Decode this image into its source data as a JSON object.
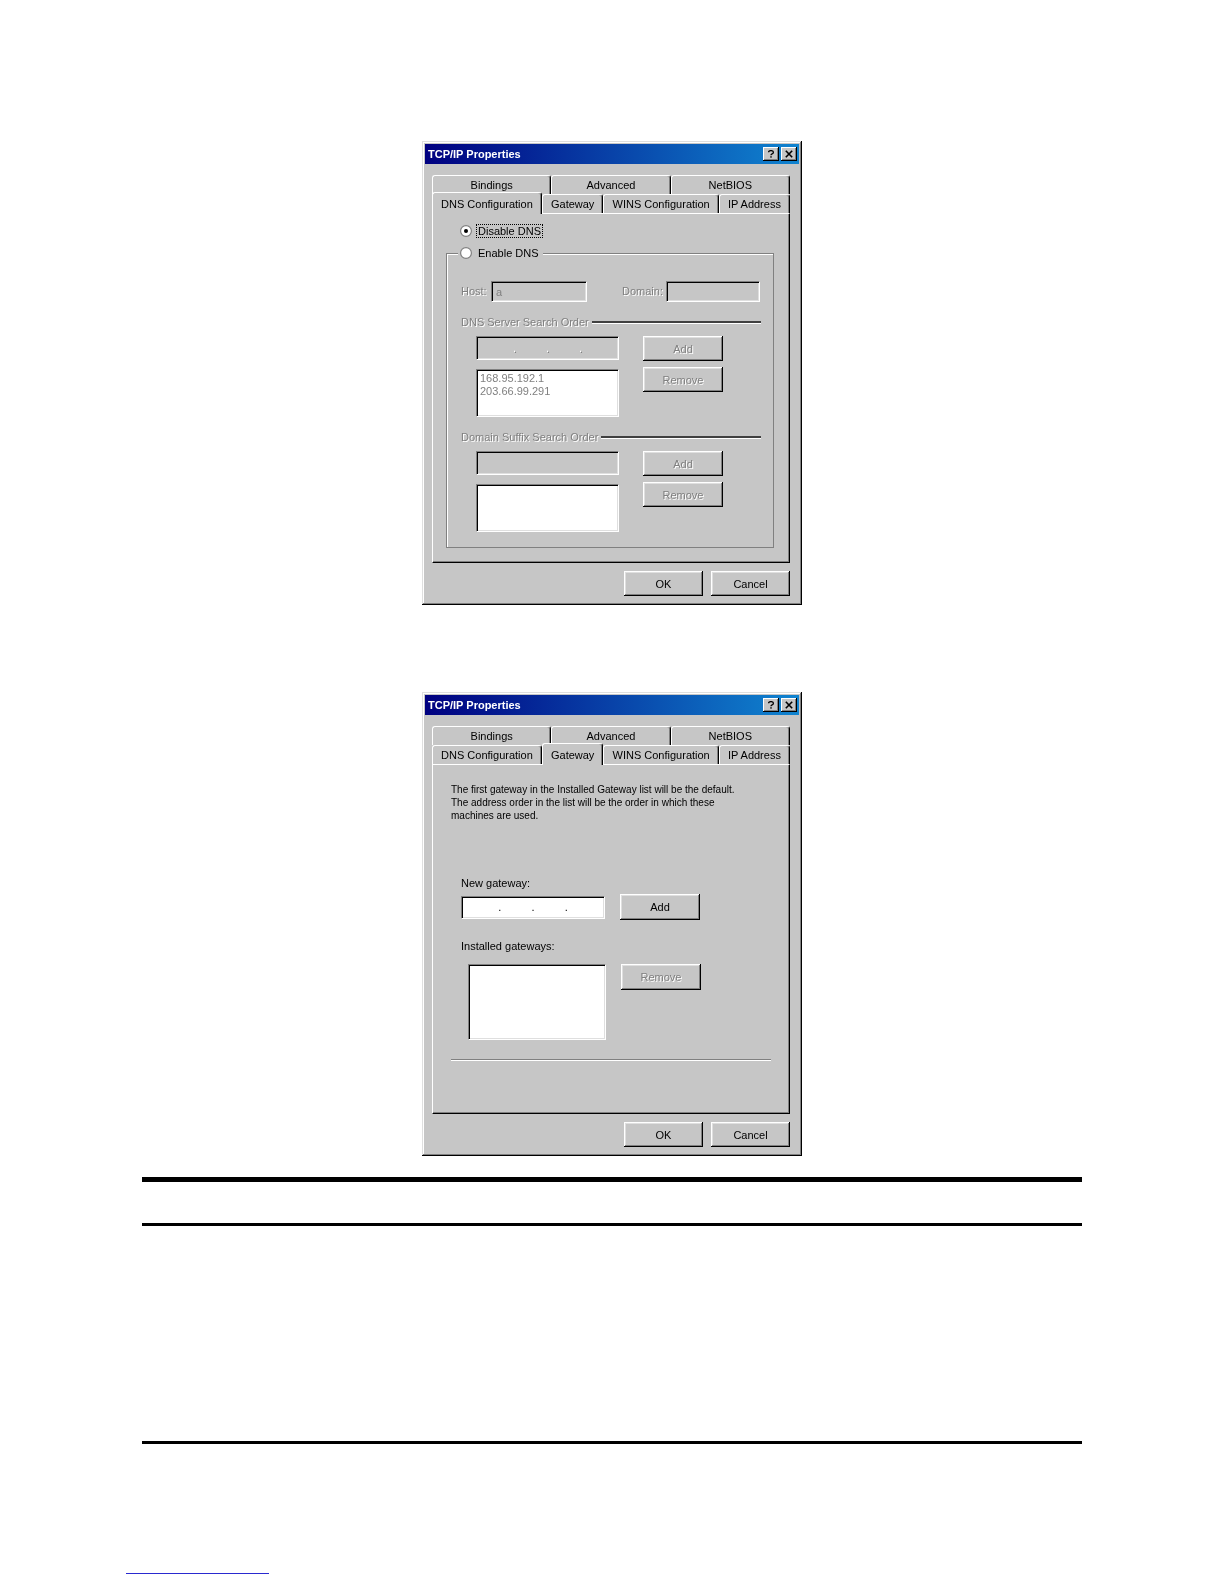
{
  "dialogs": [
    {
      "title": "TCP/IP Properties",
      "tab_rows": [
        [
          {
            "label": "Bindings",
            "selected": false
          },
          {
            "label": "Advanced",
            "selected": false
          },
          {
            "label": "NetBIOS",
            "selected": false
          }
        ],
        [
          {
            "label": "DNS Configuration",
            "selected": true
          },
          {
            "label": "Gateway",
            "selected": false
          },
          {
            "label": "WINS Configuration",
            "selected": false
          },
          {
            "label": "IP Address",
            "selected": false
          }
        ]
      ],
      "page": {
        "kind": "dns",
        "options": [
          {
            "label": "Disable DNS",
            "selected": true,
            "focused": true
          },
          {
            "label": "Enable DNS",
            "selected": false,
            "focused": false
          }
        ],
        "settings": {
          "disabled": true,
          "host": {
            "label": "Host:",
            "value": "a"
          },
          "domain": {
            "label": "Domain:"
          },
          "sections": [
            {
              "heading": "DNS Server Search Order",
              "entry": {
                "kind": "ip",
                "separators": [
                  ".",
                  ".",
                  "."
                ]
              },
              "add_button": "Add",
              "remove_button": "Remove",
              "entries": [
                "168.95.192.1",
                "203.66.99.291"
              ]
            },
            {
              "heading": "Domain Suffix Search Order",
              "entry": {
                "kind": "text"
              },
              "add_button": "Add",
              "remove_button": "Remove"
            }
          ]
        }
      },
      "buttons": [
        {
          "label": "OK"
        },
        {
          "label": "Cancel"
        }
      ]
    },
    {
      "title": "TCP/IP Properties",
      "tab_rows": [
        [
          {
            "label": "Bindings",
            "selected": false
          },
          {
            "label": "Advanced",
            "selected": false
          },
          {
            "label": "NetBIOS",
            "selected": false
          }
        ],
        [
          {
            "label": "DNS Configuration",
            "selected": false
          },
          {
            "label": "Gateway",
            "selected": true
          },
          {
            "label": "WINS Configuration",
            "selected": false
          },
          {
            "label": "IP Address",
            "selected": false
          }
        ]
      ],
      "page": {
        "kind": "gateway",
        "intro": "The first gateway in the Installed Gateway list will be the default. The address order in the list will be the order in which these machines are used.",
        "new_gateway": {
          "label": "New gateway:",
          "separators": [
            ".",
            ".",
            "."
          ],
          "add_button": {
            "label": "Add",
            "disabled": false
          }
        },
        "installed": {
          "label": "Installed gateways:",
          "remove_button": {
            "label": "Remove",
            "disabled": true
          }
        }
      },
      "buttons": [
        {
          "label": "OK"
        },
        {
          "label": "Cancel"
        }
      ]
    }
  ]
}
